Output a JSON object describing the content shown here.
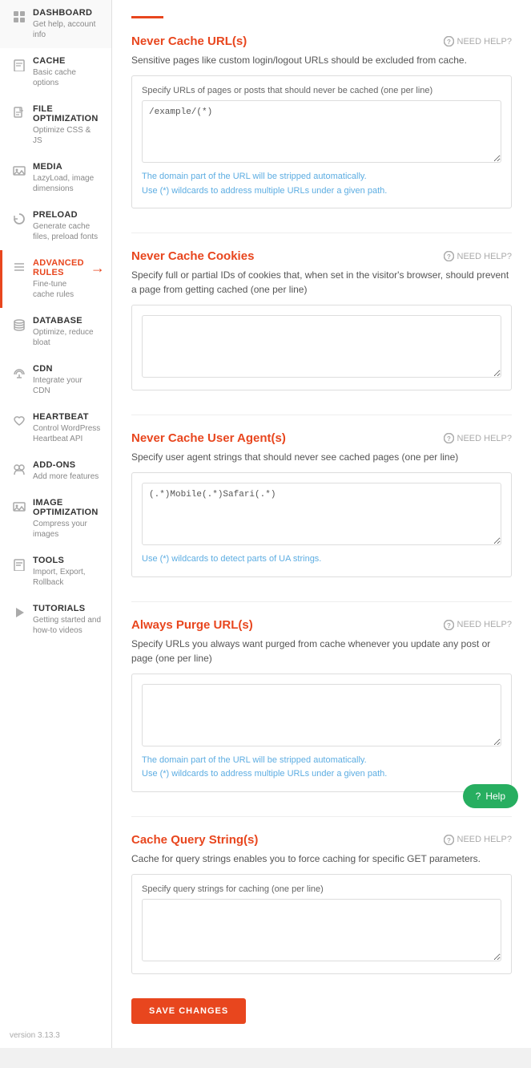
{
  "sidebar": {
    "items": [
      {
        "id": "dashboard",
        "title": "DASHBOARD",
        "desc": "Get help, account info",
        "icon": "🏠",
        "active": false
      },
      {
        "id": "cache",
        "title": "CACHE",
        "desc": "Basic cache options",
        "icon": "📄",
        "active": false
      },
      {
        "id": "file-optimization",
        "title": "FILE OPTIMIZATION",
        "desc": "Optimize CSS & JS",
        "icon": "✉",
        "active": false
      },
      {
        "id": "media",
        "title": "MEDIA",
        "desc": "LazyLoad, image dimensions",
        "icon": "🖼",
        "active": false
      },
      {
        "id": "preload",
        "title": "PRELOAD",
        "desc": "Generate cache files, preload fonts",
        "icon": "⟳",
        "active": false
      },
      {
        "id": "advanced-rules",
        "title": "ADVANCED RULES",
        "desc": "Fine-tune cache rules",
        "icon": "≡",
        "active": true
      },
      {
        "id": "database",
        "title": "DATABASE",
        "desc": "Optimize, reduce bloat",
        "icon": "🗄",
        "active": false
      },
      {
        "id": "cdn",
        "title": "CDN",
        "desc": "Integrate your CDN",
        "icon": "☁",
        "active": false
      },
      {
        "id": "heartbeat",
        "title": "HEARTBEAT",
        "desc": "Control WordPress Heartbeat API",
        "icon": "♥",
        "active": false
      },
      {
        "id": "add-ons",
        "title": "ADD-ONS",
        "desc": "Add more features",
        "icon": "👥",
        "active": false
      },
      {
        "id": "image-optimization",
        "title": "IMAGE OPTIMIZATION",
        "desc": "Compress your images",
        "icon": "🖼",
        "active": false
      },
      {
        "id": "tools",
        "title": "TOOLS",
        "desc": "Import, Export, Rollback",
        "icon": "📄",
        "active": false
      },
      {
        "id": "tutorials",
        "title": "TUTORIALS",
        "desc": "Getting started and how-to videos",
        "icon": "▶",
        "active": false
      }
    ],
    "version": "version 3.13.3"
  },
  "main": {
    "sections": [
      {
        "id": "never-cache-urls",
        "title": "Never Cache URL(s)",
        "need_help": "NEED HELP?",
        "desc": "Sensitive pages like custom login/logout URLs should be excluded from cache.",
        "field_label": "Specify URLs of pages or posts that should never be cached (one per line)",
        "textarea_value": "/example/(*)",
        "textarea_rows": 5,
        "hints": [
          "The domain part of the URL will be stripped automatically.",
          "Use (*) wildcards to address multiple URLs under a given path."
        ]
      },
      {
        "id": "never-cache-cookies",
        "title": "Never Cache Cookies",
        "need_help": "NEED HELP?",
        "desc": "Specify full or partial IDs of cookies that, when set in the visitor's browser, should prevent a page from getting cached (one per line)",
        "field_label": "",
        "textarea_value": "",
        "textarea_rows": 5,
        "hints": []
      },
      {
        "id": "never-cache-user-agent",
        "title": "Never Cache User Agent(s)",
        "need_help": "NEED HELP?",
        "desc": "Specify user agent strings that should never see cached pages (one per line)",
        "field_label": "",
        "textarea_value": "(.*)Mobile(.*)Safari(.*)",
        "textarea_rows": 5,
        "hints": [
          "Use (*) wildcards to detect parts of UA strings."
        ]
      },
      {
        "id": "always-purge-urls",
        "title": "Always Purge URL(s)",
        "need_help": "NEED HELP?",
        "desc": "Specify URLs you always want purged from cache whenever you update any post or page (one per line)",
        "field_label": "",
        "textarea_value": "",
        "textarea_rows": 5,
        "hints": [
          "The domain part of the URL will be stripped automatically.",
          "Use (*) wildcards to address multiple URLs under a given path."
        ]
      },
      {
        "id": "cache-query-strings",
        "title": "Cache Query String(s)",
        "need_help": "NEED HELP?",
        "desc": "Cache for query strings enables you to force caching for specific GET parameters.",
        "field_label": "Specify query strings for caching (one per line)",
        "textarea_value": "",
        "textarea_rows": 5,
        "hints": []
      }
    ],
    "save_button": "SAVE CHANGES",
    "help_button": "Help"
  }
}
